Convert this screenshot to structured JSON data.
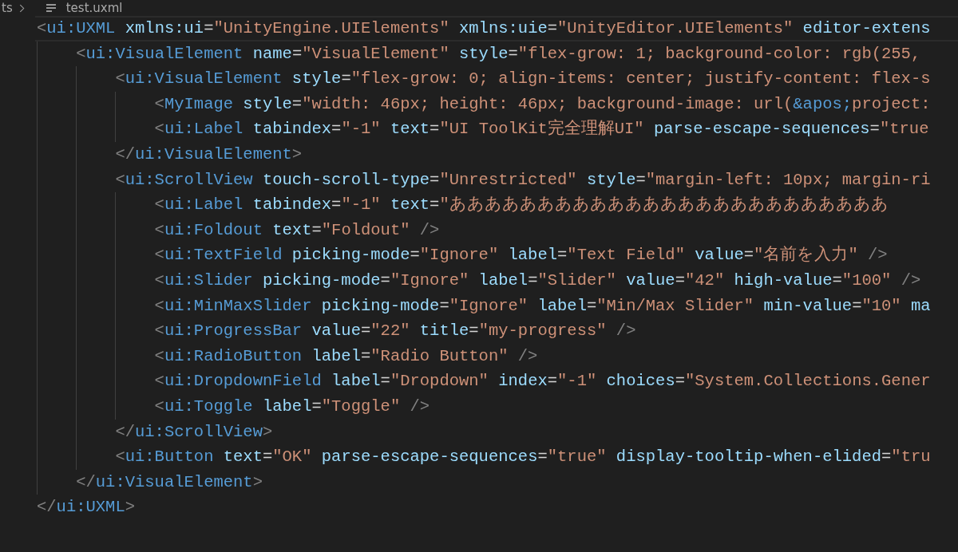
{
  "breadcrumb": [
    {
      "text": "ts",
      "kind": "folder"
    },
    {
      "text": "test.uxml",
      "kind": "file"
    }
  ],
  "lines": [
    {
      "current": true,
      "tokens": [
        {
          "kind": "punct",
          "text": "<"
        },
        {
          "kind": "tag",
          "text": "ui:UXML"
        },
        {
          "kind": "attr",
          "text": " xmlns:ui"
        },
        {
          "kind": "eq",
          "text": "="
        },
        {
          "kind": "value",
          "text": "\"UnityEngine.UIElements\""
        },
        {
          "kind": "attr",
          "text": " xmlns:uie"
        },
        {
          "kind": "eq",
          "text": "="
        },
        {
          "kind": "value",
          "text": "\"UnityEditor.UIElements\""
        },
        {
          "kind": "attr",
          "text": " editor-extens"
        }
      ],
      "children": [
        {
          "current": false,
          "tokens": [
            {
              "kind": "punct",
              "text": "<"
            },
            {
              "kind": "tag",
              "text": "ui:VisualElement"
            },
            {
              "kind": "attr",
              "text": " name"
            },
            {
              "kind": "eq",
              "text": "="
            },
            {
              "kind": "value",
              "text": "\"VisualElement\""
            },
            {
              "kind": "attr",
              "text": " style"
            },
            {
              "kind": "eq",
              "text": "="
            },
            {
              "kind": "value",
              "text": "\"flex-grow: 1; background-color: rgb(255,"
            }
          ],
          "children": [
            {
              "current": false,
              "tokens": [
                {
                  "kind": "punct",
                  "text": "<"
                },
                {
                  "kind": "tag",
                  "text": "ui:VisualElement"
                },
                {
                  "kind": "attr",
                  "text": " style"
                },
                {
                  "kind": "eq",
                  "text": "="
                },
                {
                  "kind": "value",
                  "text": "\"flex-grow: 0; align-items: center; justify-content: flex-s"
                }
              ],
              "children": [
                {
                  "current": false,
                  "tokens": [
                    {
                      "kind": "punct",
                      "text": "<"
                    },
                    {
                      "kind": "tag",
                      "text": "MyImage"
                    },
                    {
                      "kind": "attr",
                      "text": " style"
                    },
                    {
                      "kind": "eq",
                      "text": "="
                    },
                    {
                      "kind": "value",
                      "text": "\"width: 46px; height: 46px; background-image: url("
                    },
                    {
                      "kind": "entity",
                      "text": "&apos;"
                    },
                    {
                      "kind": "value",
                      "text": "project:"
                    }
                  ]
                },
                {
                  "current": false,
                  "tokens": [
                    {
                      "kind": "punct",
                      "text": "<"
                    },
                    {
                      "kind": "tag",
                      "text": "ui:Label"
                    },
                    {
                      "kind": "attr",
                      "text": " tabindex"
                    },
                    {
                      "kind": "eq",
                      "text": "="
                    },
                    {
                      "kind": "value",
                      "text": "\"-1\""
                    },
                    {
                      "kind": "attr",
                      "text": " text"
                    },
                    {
                      "kind": "eq",
                      "text": "="
                    },
                    {
                      "kind": "value",
                      "text": "\"UI ToolKit完全理解UI\""
                    },
                    {
                      "kind": "attr",
                      "text": " parse-escape-sequences"
                    },
                    {
                      "kind": "eq",
                      "text": "="
                    },
                    {
                      "kind": "value",
                      "text": "\"true"
                    }
                  ]
                }
              ]
            },
            {
              "current": false,
              "tokens": [
                {
                  "kind": "punct",
                  "text": "</"
                },
                {
                  "kind": "tag",
                  "text": "ui:VisualElement"
                },
                {
                  "kind": "punct",
                  "text": ">"
                }
              ]
            },
            {
              "current": false,
              "tokens": [
                {
                  "kind": "punct",
                  "text": "<"
                },
                {
                  "kind": "tag",
                  "text": "ui:ScrollView"
                },
                {
                  "kind": "attr",
                  "text": " touch-scroll-type"
                },
                {
                  "kind": "eq",
                  "text": "="
                },
                {
                  "kind": "value",
                  "text": "\"Unrestricted\""
                },
                {
                  "kind": "attr",
                  "text": " style"
                },
                {
                  "kind": "eq",
                  "text": "="
                },
                {
                  "kind": "value",
                  "text": "\"margin-left: 10px; margin-ri"
                }
              ],
              "children": [
                {
                  "current": false,
                  "tokens": [
                    {
                      "kind": "punct",
                      "text": "<"
                    },
                    {
                      "kind": "tag",
                      "text": "ui:Label"
                    },
                    {
                      "kind": "attr",
                      "text": " tabindex"
                    },
                    {
                      "kind": "eq",
                      "text": "="
                    },
                    {
                      "kind": "value",
                      "text": "\"-1\""
                    },
                    {
                      "kind": "attr",
                      "text": " text"
                    },
                    {
                      "kind": "eq",
                      "text": "="
                    },
                    {
                      "kind": "value",
                      "text": "\"あああああああああああああああああああああああああ"
                    }
                  ]
                },
                {
                  "current": false,
                  "tokens": [
                    {
                      "kind": "punct",
                      "text": "<"
                    },
                    {
                      "kind": "tag",
                      "text": "ui:Foldout"
                    },
                    {
                      "kind": "attr",
                      "text": " text"
                    },
                    {
                      "kind": "eq",
                      "text": "="
                    },
                    {
                      "kind": "value",
                      "text": "\"Foldout\""
                    },
                    {
                      "kind": "punct",
                      "text": " />"
                    }
                  ]
                },
                {
                  "current": false,
                  "tokens": [
                    {
                      "kind": "punct",
                      "text": "<"
                    },
                    {
                      "kind": "tag",
                      "text": "ui:TextField"
                    },
                    {
                      "kind": "attr",
                      "text": " picking-mode"
                    },
                    {
                      "kind": "eq",
                      "text": "="
                    },
                    {
                      "kind": "value",
                      "text": "\"Ignore\""
                    },
                    {
                      "kind": "attr",
                      "text": " label"
                    },
                    {
                      "kind": "eq",
                      "text": "="
                    },
                    {
                      "kind": "value",
                      "text": "\"Text Field\""
                    },
                    {
                      "kind": "attr",
                      "text": " value"
                    },
                    {
                      "kind": "eq",
                      "text": "="
                    },
                    {
                      "kind": "value",
                      "text": "\"名前を入力\""
                    },
                    {
                      "kind": "punct",
                      "text": " />"
                    }
                  ]
                },
                {
                  "current": false,
                  "tokens": [
                    {
                      "kind": "punct",
                      "text": "<"
                    },
                    {
                      "kind": "tag",
                      "text": "ui:Slider"
                    },
                    {
                      "kind": "attr",
                      "text": " picking-mode"
                    },
                    {
                      "kind": "eq",
                      "text": "="
                    },
                    {
                      "kind": "value",
                      "text": "\"Ignore\""
                    },
                    {
                      "kind": "attr",
                      "text": " label"
                    },
                    {
                      "kind": "eq",
                      "text": "="
                    },
                    {
                      "kind": "value",
                      "text": "\"Slider\""
                    },
                    {
                      "kind": "attr",
                      "text": " value"
                    },
                    {
                      "kind": "eq",
                      "text": "="
                    },
                    {
                      "kind": "value",
                      "text": "\"42\""
                    },
                    {
                      "kind": "attr",
                      "text": " high-value"
                    },
                    {
                      "kind": "eq",
                      "text": "="
                    },
                    {
                      "kind": "value",
                      "text": "\"100\""
                    },
                    {
                      "kind": "punct",
                      "text": " />"
                    }
                  ]
                },
                {
                  "current": false,
                  "tokens": [
                    {
                      "kind": "punct",
                      "text": "<"
                    },
                    {
                      "kind": "tag",
                      "text": "ui:MinMaxSlider"
                    },
                    {
                      "kind": "attr",
                      "text": " picking-mode"
                    },
                    {
                      "kind": "eq",
                      "text": "="
                    },
                    {
                      "kind": "value",
                      "text": "\"Ignore\""
                    },
                    {
                      "kind": "attr",
                      "text": " label"
                    },
                    {
                      "kind": "eq",
                      "text": "="
                    },
                    {
                      "kind": "value",
                      "text": "\"Min/Max Slider\""
                    },
                    {
                      "kind": "attr",
                      "text": " min-value"
                    },
                    {
                      "kind": "eq",
                      "text": "="
                    },
                    {
                      "kind": "value",
                      "text": "\"10\""
                    },
                    {
                      "kind": "attr",
                      "text": " ma"
                    }
                  ]
                },
                {
                  "current": false,
                  "tokens": [
                    {
                      "kind": "punct",
                      "text": "<"
                    },
                    {
                      "kind": "tag",
                      "text": "ui:ProgressBar"
                    },
                    {
                      "kind": "attr",
                      "text": " value"
                    },
                    {
                      "kind": "eq",
                      "text": "="
                    },
                    {
                      "kind": "value",
                      "text": "\"22\""
                    },
                    {
                      "kind": "attr",
                      "text": " title"
                    },
                    {
                      "kind": "eq",
                      "text": "="
                    },
                    {
                      "kind": "value",
                      "text": "\"my-progress\""
                    },
                    {
                      "kind": "punct",
                      "text": " />"
                    }
                  ]
                },
                {
                  "current": false,
                  "tokens": [
                    {
                      "kind": "punct",
                      "text": "<"
                    },
                    {
                      "kind": "tag",
                      "text": "ui:RadioButton"
                    },
                    {
                      "kind": "attr",
                      "text": " label"
                    },
                    {
                      "kind": "eq",
                      "text": "="
                    },
                    {
                      "kind": "value",
                      "text": "\"Radio Button\""
                    },
                    {
                      "kind": "punct",
                      "text": " />"
                    }
                  ]
                },
                {
                  "current": false,
                  "tokens": [
                    {
                      "kind": "punct",
                      "text": "<"
                    },
                    {
                      "kind": "tag",
                      "text": "ui:DropdownField"
                    },
                    {
                      "kind": "attr",
                      "text": " label"
                    },
                    {
                      "kind": "eq",
                      "text": "="
                    },
                    {
                      "kind": "value",
                      "text": "\"Dropdown\""
                    },
                    {
                      "kind": "attr",
                      "text": " index"
                    },
                    {
                      "kind": "eq",
                      "text": "="
                    },
                    {
                      "kind": "value",
                      "text": "\"-1\""
                    },
                    {
                      "kind": "attr",
                      "text": " choices"
                    },
                    {
                      "kind": "eq",
                      "text": "="
                    },
                    {
                      "kind": "value",
                      "text": "\"System.Collections.Gener"
                    }
                  ]
                },
                {
                  "current": false,
                  "tokens": [
                    {
                      "kind": "punct",
                      "text": "<"
                    },
                    {
                      "kind": "tag",
                      "text": "ui:Toggle"
                    },
                    {
                      "kind": "attr",
                      "text": " label"
                    },
                    {
                      "kind": "eq",
                      "text": "="
                    },
                    {
                      "kind": "value",
                      "text": "\"Toggle\""
                    },
                    {
                      "kind": "punct",
                      "text": " />"
                    }
                  ]
                }
              ]
            },
            {
              "current": false,
              "tokens": [
                {
                  "kind": "punct",
                  "text": "</"
                },
                {
                  "kind": "tag",
                  "text": "ui:ScrollView"
                },
                {
                  "kind": "punct",
                  "text": ">"
                }
              ]
            },
            {
              "current": false,
              "tokens": [
                {
                  "kind": "punct",
                  "text": "<"
                },
                {
                  "kind": "tag",
                  "text": "ui:Button"
                },
                {
                  "kind": "attr",
                  "text": " text"
                },
                {
                  "kind": "eq",
                  "text": "="
                },
                {
                  "kind": "value",
                  "text": "\"OK\""
                },
                {
                  "kind": "attr",
                  "text": " parse-escape-sequences"
                },
                {
                  "kind": "eq",
                  "text": "="
                },
                {
                  "kind": "value",
                  "text": "\"true\""
                },
                {
                  "kind": "attr",
                  "text": " display-tooltip-when-elided"
                },
                {
                  "kind": "eq",
                  "text": "="
                },
                {
                  "kind": "value",
                  "text": "\"tru"
                }
              ]
            }
          ]
        },
        {
          "current": false,
          "tokens": [
            {
              "kind": "punct",
              "text": "</"
            },
            {
              "kind": "tag",
              "text": "ui:VisualElement"
            },
            {
              "kind": "punct",
              "text": ">"
            }
          ]
        }
      ]
    },
    {
      "current": false,
      "tokens": [
        {
          "kind": "punct",
          "text": "</"
        },
        {
          "kind": "tag",
          "text": "ui:UXML"
        },
        {
          "kind": "punct",
          "text": ">"
        }
      ]
    }
  ]
}
